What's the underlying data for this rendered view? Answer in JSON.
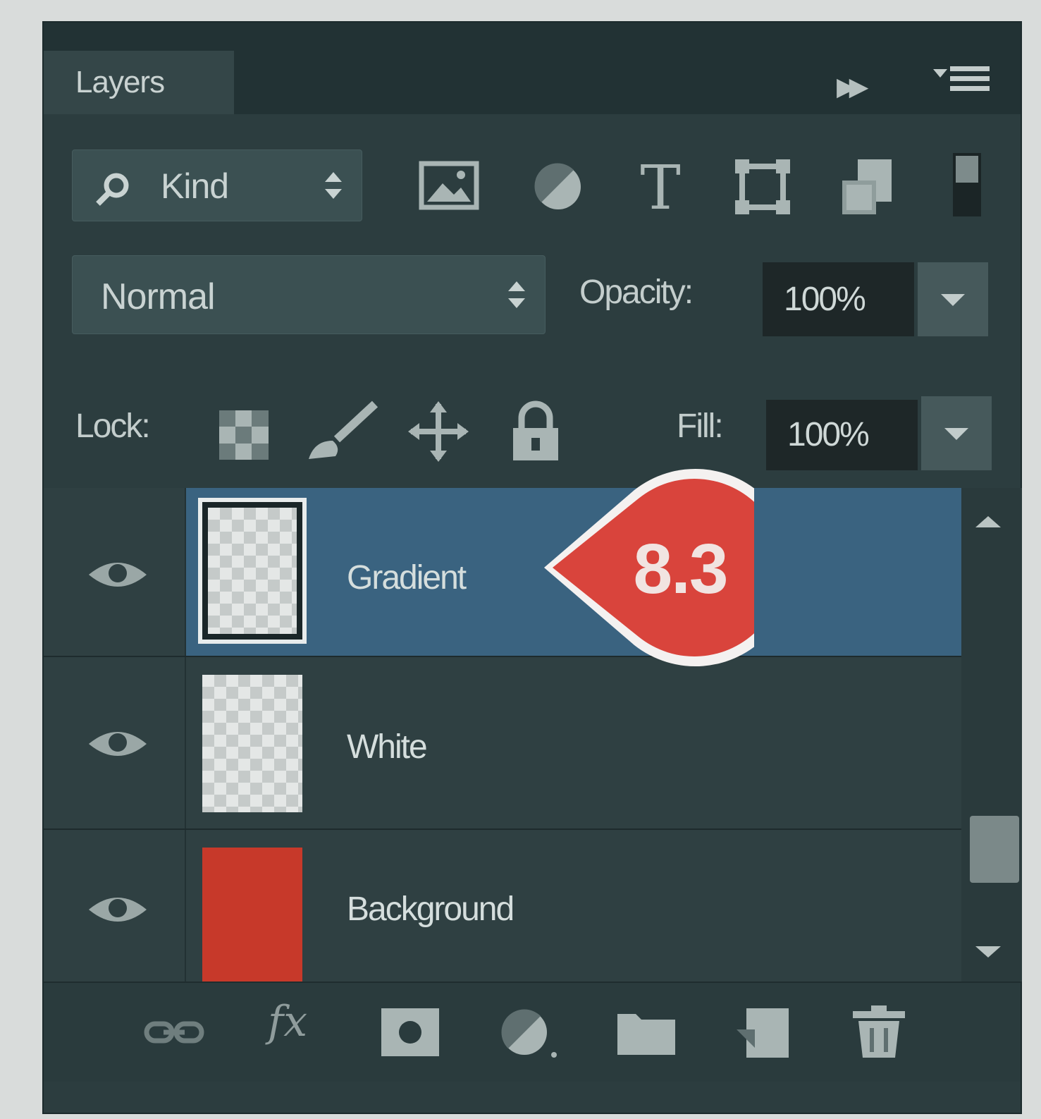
{
  "panel": {
    "tab_label": "Layers"
  },
  "filter": {
    "kind_label": "Kind",
    "filter_icons": [
      "image-filter-icon",
      "adjustment-filter-icon",
      "type-filter-icon",
      "shape-filter-icon",
      "smart-object-filter-icon"
    ]
  },
  "blend": {
    "mode": "Normal",
    "opacity_label": "Opacity:",
    "opacity_value": "100%"
  },
  "lock": {
    "label": "Lock:",
    "fill_label": "Fill:",
    "fill_value": "100%",
    "icons": [
      "lock-transparent-icon",
      "lock-image-icon",
      "lock-position-icon",
      "lock-all-icon"
    ]
  },
  "layers": [
    {
      "name": "Gradient",
      "visible": true,
      "selected": true,
      "thumbnail": "transparent"
    },
    {
      "name": "White",
      "visible": true,
      "selected": false,
      "thumbnail": "transparent"
    },
    {
      "name": "Background",
      "visible": true,
      "selected": false,
      "thumbnail": "#c7392a"
    }
  ],
  "badge": {
    "text": "8.3",
    "color": "#d9443c"
  },
  "bottom_icons": [
    "link-icon",
    "fx-icon",
    "mask-icon",
    "adjustment-icon",
    "folder-icon",
    "new-layer-icon",
    "trash-icon"
  ],
  "bottom": {
    "fx_label": "fx"
  }
}
